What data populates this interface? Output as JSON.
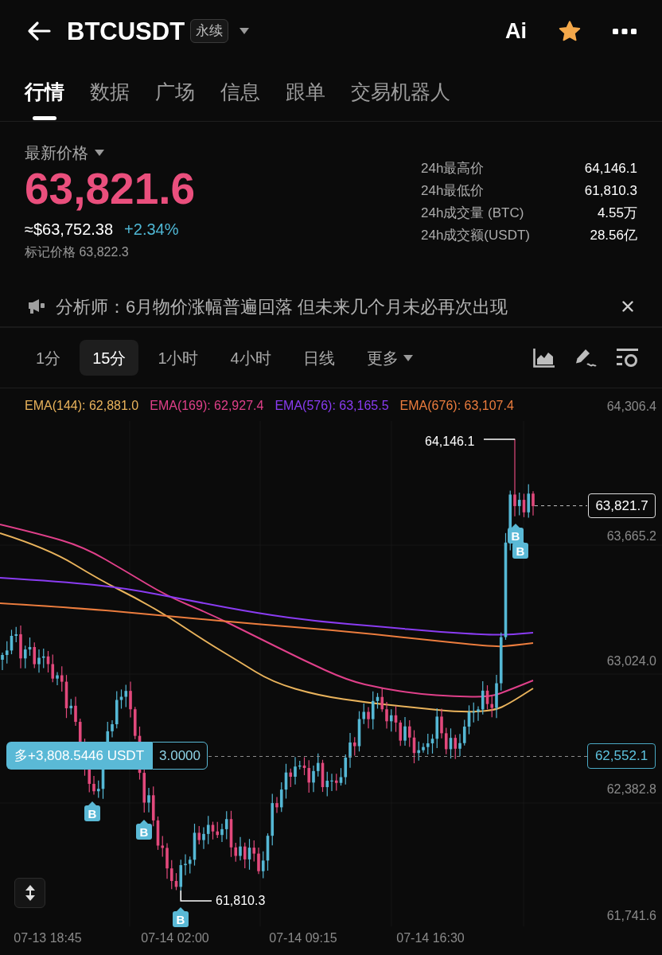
{
  "header": {
    "symbol": "BTCUSDT",
    "contract_badge": "永续",
    "ai_label": "Ai",
    "favorite": true
  },
  "tabs": [
    {
      "label": "行情",
      "selected": true
    },
    {
      "label": "数据",
      "selected": false
    },
    {
      "label": "广场",
      "selected": false
    },
    {
      "label": "信息",
      "selected": false
    },
    {
      "label": "跟单",
      "selected": false
    },
    {
      "label": "交易机器人",
      "selected": false
    }
  ],
  "price": {
    "title": "最新价格",
    "last": "63,821.6",
    "usd": "≈$63,752.38",
    "change": "+2.34%",
    "mark": "标记价格 63,822.3"
  },
  "stats": [
    {
      "label": "24h最高价",
      "value": "64,146.1"
    },
    {
      "label": "24h最低价",
      "value": "61,810.3"
    },
    {
      "label": "24h成交量 (BTC)",
      "value": "4.55万"
    },
    {
      "label": "24h成交额(USDT)",
      "value": "28.56亿"
    }
  ],
  "notice": {
    "text": "分析师：6月物价涨幅普遍回落 但未来几个月未必再次出现"
  },
  "intervals": [
    {
      "label": "1分",
      "kind": "interval",
      "selected": false
    },
    {
      "label": "15分",
      "kind": "interval",
      "selected": true
    },
    {
      "label": "1小时",
      "kind": "interval",
      "selected": false
    },
    {
      "label": "4小时",
      "kind": "interval",
      "selected": false
    },
    {
      "label": "日线",
      "kind": "interval",
      "selected": false
    },
    {
      "label": "更多",
      "kind": "menu",
      "selected": false
    }
  ],
  "chart": {
    "indicators": [
      {
        "label": "EMA(144): 62,881.0",
        "color": "#e9b35c"
      },
      {
        "label": "EMA(169): 62,927.4",
        "color": "#e0408a"
      },
      {
        "label": "EMA(576): 63,165.5",
        "color": "#8a3cf2"
      },
      {
        "label": "EMA(676): 63,107.4",
        "color": "#ec7d3e"
      }
    ],
    "price_axis": [
      "64,306.4",
      "63,665.2",
      "63,024.0",
      "62,382.8",
      "61,741.6"
    ],
    "time_axis": [
      "07-13 18:45",
      "07-14 02:00",
      "07-14 09:15",
      "07-14 16:30"
    ],
    "high_label": "64,146.1",
    "low_label": "61,810.3",
    "last_price": "63,821.7",
    "position": {
      "pnl": "多+3,808.5446 USDT",
      "size": "3.0000",
      "entry_price": "62,552.1"
    },
    "markers": [
      {
        "label": "B"
      },
      {
        "label": "B"
      },
      {
        "label": "B"
      },
      {
        "label": "B"
      },
      {
        "label": "B"
      }
    ]
  }
}
